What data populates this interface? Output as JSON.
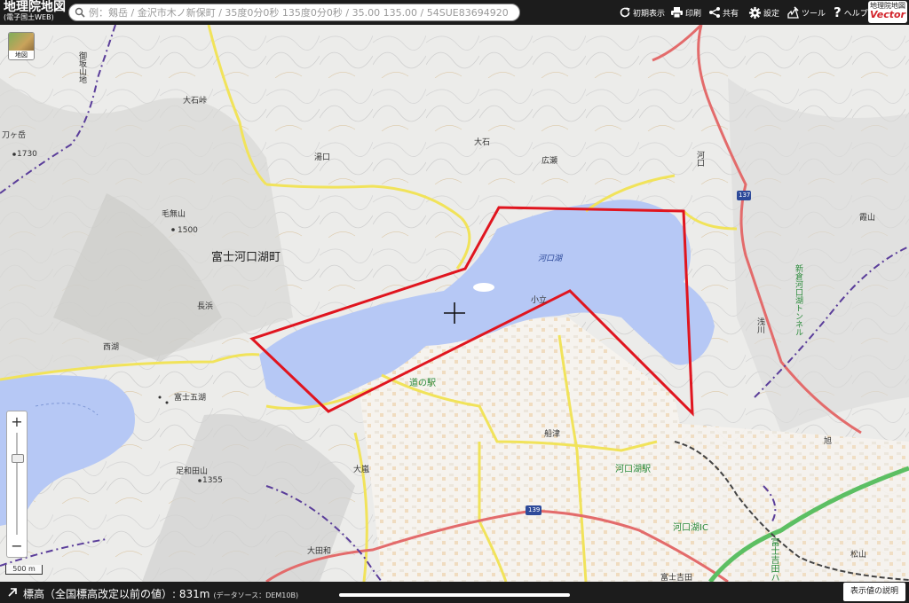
{
  "header": {
    "logo_title": "地理院地図",
    "logo_sub": "(電子国土WEB)",
    "search_placeholder": "例：剱岳 / 金沢市木ノ新保町 / 35度0分0秒 135度0分0秒 / 35.00 135.00 / 54SUE83694920",
    "buttons": {
      "reset": "初期表示",
      "print": "印刷",
      "share": "共有",
      "settings": "設定",
      "tools": "ツール",
      "help": "ヘルプ"
    },
    "brand_top": "地理院地図",
    "brand_bottom": "Vector"
  },
  "map": {
    "layer_button": "地図",
    "scale_label": "500 m",
    "labels": {
      "gosaka": "御坂山地",
      "oishi_pass": "大石峠",
      "katana": "刀ヶ岳",
      "spot1730": "1730",
      "yuguchi": "湯口",
      "oishi": "大石",
      "hirose": "広瀬",
      "kawaguchi_area": "河口",
      "kenmuyama": "毛無山",
      "spot1500": "1500",
      "town": "富士河口湖町",
      "lake": "河口湖",
      "kodachi": "小立",
      "nagahama": "長浜",
      "saiko_area": "西湖",
      "fuji_five": "富士五湖",
      "michi_no_eki": "道の駅",
      "funatsu": "船津",
      "kawaguchiko_station": "河口湖駅",
      "ashiwada": "足和田山",
      "spot1355": "1355",
      "oarashi": "大嵐",
      "otawa": "大田和",
      "asakawa": "浅川",
      "kasumiyama": "霞山",
      "tunnel": "新倉河口湖トンネル",
      "asahi": "旭",
      "matsuyama": "松山",
      "ic": "河口湖IC",
      "highway": "富士吉田ハイ",
      "road137": "137",
      "road139": "139",
      "bottom_text": "富士吉田"
    }
  },
  "footer": {
    "elevation_label": "標高（全国標高改定以前の値）: 831m",
    "data_source": "(データソース：DEM10B)",
    "explain_button": "表示値の説明"
  },
  "colors": {
    "lake": "#b6c8f5",
    "polygon": "#e0151f",
    "road_yellow": "#f1e35a",
    "road_red": "#e36b6b",
    "expressway": "#5cbf63",
    "boundary": "#5a3d9a"
  }
}
